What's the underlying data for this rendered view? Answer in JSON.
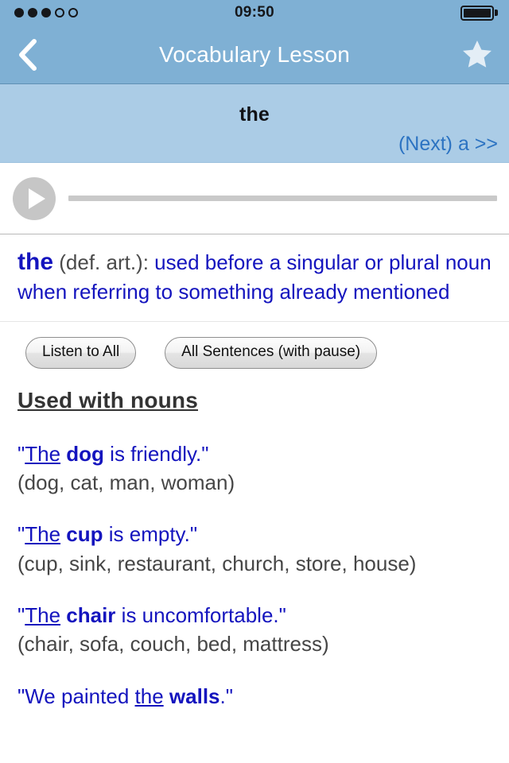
{
  "status_bar": {
    "time": "09:50",
    "signal_filled": 3,
    "signal_total": 5,
    "battery_icon": "battery-full-icon"
  },
  "nav": {
    "back_icon": "chevron-left-icon",
    "title": "Vocabulary Lesson",
    "star_icon": "star-icon"
  },
  "word_band": {
    "word": "the",
    "next_link": "(Next) a >>"
  },
  "player": {
    "play_icon": "play-icon",
    "progress_percent": 0
  },
  "definition": {
    "headword": "the",
    "part_of_speech": "(def. art.):",
    "text": " used before a singular or plural noun when referring to something already mentioned"
  },
  "buttons": {
    "listen_all": "Listen to All",
    "all_sentences": "All Sentences (with pause)"
  },
  "section": {
    "heading": "Used with nouns",
    "sentences": [
      {
        "prefix": "\"",
        "article": "The",
        "gap1": " ",
        "keyword": "dog",
        "rest": " is friendly.\"",
        "alternatives": "(dog, cat, man, woman)"
      },
      {
        "prefix": "\"",
        "article": "The",
        "gap1": " ",
        "keyword": "cup",
        "rest": " is empty.\"",
        "alternatives": "(cup, sink, restaurant, church, store, house)"
      },
      {
        "prefix": "\"",
        "article": "The",
        "gap1": " ",
        "keyword": "chair",
        "rest": " is uncomfortable.\"",
        "alternatives": "(chair, sofa, couch, bed, mattress)"
      },
      {
        "prefix": "\"We painted ",
        "article": "the",
        "gap1": " ",
        "keyword": "walls",
        "rest": ".\"",
        "alternatives": ""
      }
    ]
  },
  "colors": {
    "navbar": "#7FB0D4",
    "word_band": "#ABCCE6",
    "link_blue": "#2C73C2",
    "text_blue": "#1414BE",
    "gray_text": "#464646"
  }
}
